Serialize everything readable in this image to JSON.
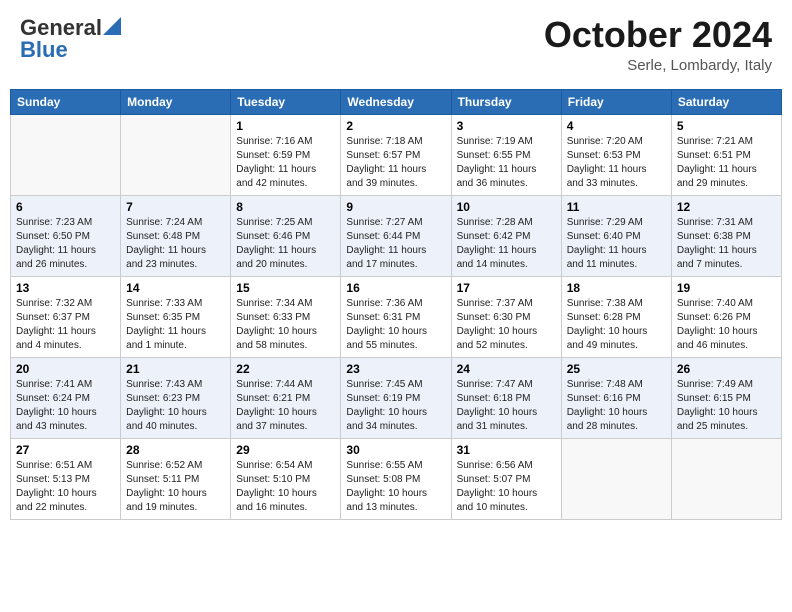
{
  "header": {
    "logo_general": "General",
    "logo_blue": "Blue",
    "month_title": "October 2024",
    "location": "Serle, Lombardy, Italy"
  },
  "weekdays": [
    "Sunday",
    "Monday",
    "Tuesday",
    "Wednesday",
    "Thursday",
    "Friday",
    "Saturday"
  ],
  "weeks": [
    [
      {
        "day": "",
        "sunrise": "",
        "sunset": "",
        "daylight": ""
      },
      {
        "day": "",
        "sunrise": "",
        "sunset": "",
        "daylight": ""
      },
      {
        "day": "1",
        "sunrise": "Sunrise: 7:16 AM",
        "sunset": "Sunset: 6:59 PM",
        "daylight": "Daylight: 11 hours and 42 minutes."
      },
      {
        "day": "2",
        "sunrise": "Sunrise: 7:18 AM",
        "sunset": "Sunset: 6:57 PM",
        "daylight": "Daylight: 11 hours and 39 minutes."
      },
      {
        "day": "3",
        "sunrise": "Sunrise: 7:19 AM",
        "sunset": "Sunset: 6:55 PM",
        "daylight": "Daylight: 11 hours and 36 minutes."
      },
      {
        "day": "4",
        "sunrise": "Sunrise: 7:20 AM",
        "sunset": "Sunset: 6:53 PM",
        "daylight": "Daylight: 11 hours and 33 minutes."
      },
      {
        "day": "5",
        "sunrise": "Sunrise: 7:21 AM",
        "sunset": "Sunset: 6:51 PM",
        "daylight": "Daylight: 11 hours and 29 minutes."
      }
    ],
    [
      {
        "day": "6",
        "sunrise": "Sunrise: 7:23 AM",
        "sunset": "Sunset: 6:50 PM",
        "daylight": "Daylight: 11 hours and 26 minutes."
      },
      {
        "day": "7",
        "sunrise": "Sunrise: 7:24 AM",
        "sunset": "Sunset: 6:48 PM",
        "daylight": "Daylight: 11 hours and 23 minutes."
      },
      {
        "day": "8",
        "sunrise": "Sunrise: 7:25 AM",
        "sunset": "Sunset: 6:46 PM",
        "daylight": "Daylight: 11 hours and 20 minutes."
      },
      {
        "day": "9",
        "sunrise": "Sunrise: 7:27 AM",
        "sunset": "Sunset: 6:44 PM",
        "daylight": "Daylight: 11 hours and 17 minutes."
      },
      {
        "day": "10",
        "sunrise": "Sunrise: 7:28 AM",
        "sunset": "Sunset: 6:42 PM",
        "daylight": "Daylight: 11 hours and 14 minutes."
      },
      {
        "day": "11",
        "sunrise": "Sunrise: 7:29 AM",
        "sunset": "Sunset: 6:40 PM",
        "daylight": "Daylight: 11 hours and 11 minutes."
      },
      {
        "day": "12",
        "sunrise": "Sunrise: 7:31 AM",
        "sunset": "Sunset: 6:38 PM",
        "daylight": "Daylight: 11 hours and 7 minutes."
      }
    ],
    [
      {
        "day": "13",
        "sunrise": "Sunrise: 7:32 AM",
        "sunset": "Sunset: 6:37 PM",
        "daylight": "Daylight: 11 hours and 4 minutes."
      },
      {
        "day": "14",
        "sunrise": "Sunrise: 7:33 AM",
        "sunset": "Sunset: 6:35 PM",
        "daylight": "Daylight: 11 hours and 1 minute."
      },
      {
        "day": "15",
        "sunrise": "Sunrise: 7:34 AM",
        "sunset": "Sunset: 6:33 PM",
        "daylight": "Daylight: 10 hours and 58 minutes."
      },
      {
        "day": "16",
        "sunrise": "Sunrise: 7:36 AM",
        "sunset": "Sunset: 6:31 PM",
        "daylight": "Daylight: 10 hours and 55 minutes."
      },
      {
        "day": "17",
        "sunrise": "Sunrise: 7:37 AM",
        "sunset": "Sunset: 6:30 PM",
        "daylight": "Daylight: 10 hours and 52 minutes."
      },
      {
        "day": "18",
        "sunrise": "Sunrise: 7:38 AM",
        "sunset": "Sunset: 6:28 PM",
        "daylight": "Daylight: 10 hours and 49 minutes."
      },
      {
        "day": "19",
        "sunrise": "Sunrise: 7:40 AM",
        "sunset": "Sunset: 6:26 PM",
        "daylight": "Daylight: 10 hours and 46 minutes."
      }
    ],
    [
      {
        "day": "20",
        "sunrise": "Sunrise: 7:41 AM",
        "sunset": "Sunset: 6:24 PM",
        "daylight": "Daylight: 10 hours and 43 minutes."
      },
      {
        "day": "21",
        "sunrise": "Sunrise: 7:43 AM",
        "sunset": "Sunset: 6:23 PM",
        "daylight": "Daylight: 10 hours and 40 minutes."
      },
      {
        "day": "22",
        "sunrise": "Sunrise: 7:44 AM",
        "sunset": "Sunset: 6:21 PM",
        "daylight": "Daylight: 10 hours and 37 minutes."
      },
      {
        "day": "23",
        "sunrise": "Sunrise: 7:45 AM",
        "sunset": "Sunset: 6:19 PM",
        "daylight": "Daylight: 10 hours and 34 minutes."
      },
      {
        "day": "24",
        "sunrise": "Sunrise: 7:47 AM",
        "sunset": "Sunset: 6:18 PM",
        "daylight": "Daylight: 10 hours and 31 minutes."
      },
      {
        "day": "25",
        "sunrise": "Sunrise: 7:48 AM",
        "sunset": "Sunset: 6:16 PM",
        "daylight": "Daylight: 10 hours and 28 minutes."
      },
      {
        "day": "26",
        "sunrise": "Sunrise: 7:49 AM",
        "sunset": "Sunset: 6:15 PM",
        "daylight": "Daylight: 10 hours and 25 minutes."
      }
    ],
    [
      {
        "day": "27",
        "sunrise": "Sunrise: 6:51 AM",
        "sunset": "Sunset: 5:13 PM",
        "daylight": "Daylight: 10 hours and 22 minutes."
      },
      {
        "day": "28",
        "sunrise": "Sunrise: 6:52 AM",
        "sunset": "Sunset: 5:11 PM",
        "daylight": "Daylight: 10 hours and 19 minutes."
      },
      {
        "day": "29",
        "sunrise": "Sunrise: 6:54 AM",
        "sunset": "Sunset: 5:10 PM",
        "daylight": "Daylight: 10 hours and 16 minutes."
      },
      {
        "day": "30",
        "sunrise": "Sunrise: 6:55 AM",
        "sunset": "Sunset: 5:08 PM",
        "daylight": "Daylight: 10 hours and 13 minutes."
      },
      {
        "day": "31",
        "sunrise": "Sunrise: 6:56 AM",
        "sunset": "Sunset: 5:07 PM",
        "daylight": "Daylight: 10 hours and 10 minutes."
      },
      {
        "day": "",
        "sunrise": "",
        "sunset": "",
        "daylight": ""
      },
      {
        "day": "",
        "sunrise": "",
        "sunset": "",
        "daylight": ""
      }
    ]
  ]
}
